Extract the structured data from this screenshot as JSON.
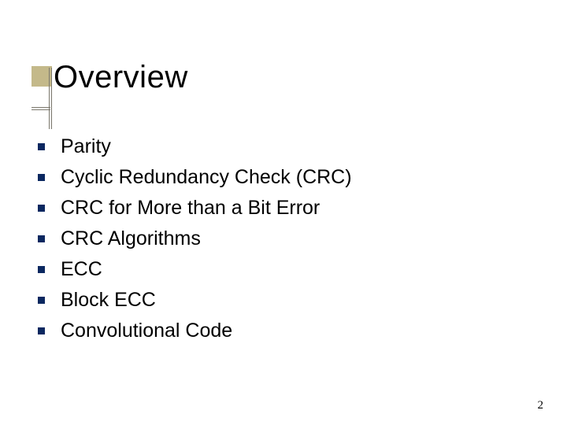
{
  "slide": {
    "title": "Overview",
    "bullets": [
      "Parity",
      "Cyclic Redundancy Check (CRC)",
      "CRC for More than a Bit Error",
      "CRC Algorithms",
      "ECC",
      "Block ECC",
      "Convolutional Code"
    ],
    "page_number": "2"
  }
}
